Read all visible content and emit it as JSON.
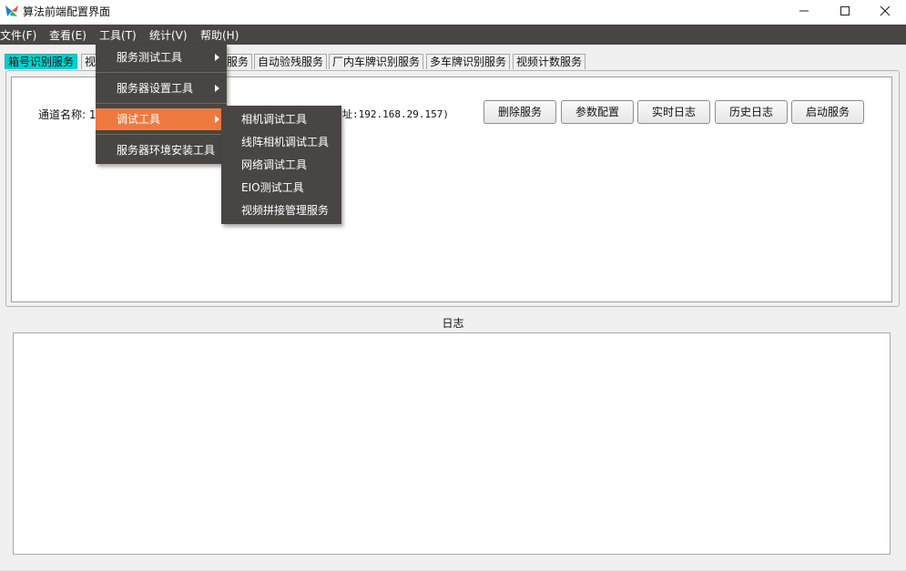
{
  "window": {
    "title": "算法前端配置界面",
    "controls": {
      "minimize": "minimize-icon",
      "maximize": "maximize-icon",
      "close": "close-icon"
    }
  },
  "menubar": {
    "items": [
      "文件(F)",
      "查看(E)",
      "工具(T)",
      "统计(V)",
      "帮助(H)"
    ]
  },
  "tabs": [
    "箱号识别服务",
    "视",
    "服务",
    "自动验残服务",
    "厂内车牌识别服务",
    "多车牌识别服务",
    "视频计数服务"
  ],
  "service_panel": {
    "channel_label": "通道名称: 1",
    "channel_tail": "址:192.168.29.157)",
    "buttons": [
      "删除服务",
      "参数配置",
      "实时日志",
      "历史日志",
      "启动服务"
    ]
  },
  "log": {
    "title": "日志"
  },
  "tools_menu": {
    "items": [
      "服务测试工具",
      "服务器设置工具",
      "调试工具",
      "服务器环境安装工具"
    ],
    "highlighted": "调试工具",
    "highlight_color": "#ee7a3f"
  },
  "debug_submenu": {
    "items": [
      "相机调试工具",
      "线阵相机调试工具",
      "网络调试工具",
      "EIO测试工具",
      "视频拼接管理服务"
    ]
  },
  "colors": {
    "menubar_bg": "#484642",
    "active_tab": "#00d0d0",
    "menu_highlight": "#ee7a3f"
  }
}
